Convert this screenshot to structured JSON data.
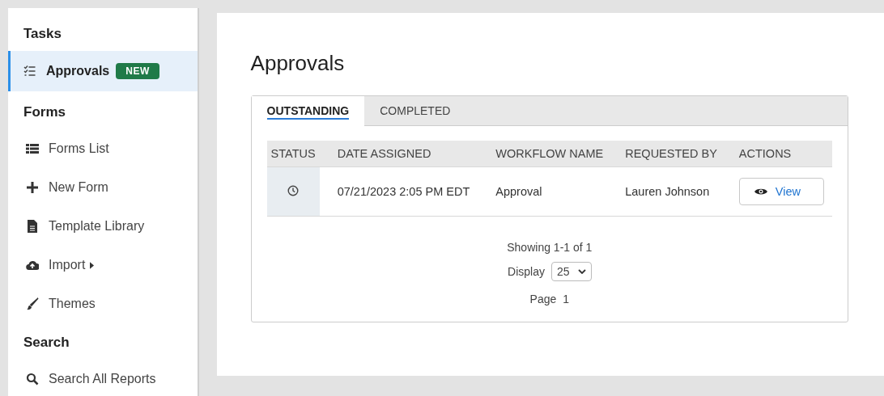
{
  "sidebar": {
    "sections": [
      {
        "heading": "Tasks",
        "items": [
          {
            "label": "Approvals",
            "badge": "NEW",
            "selected": true,
            "submenu": false
          }
        ]
      },
      {
        "heading": "Forms",
        "items": [
          {
            "label": "Forms List",
            "selected": false,
            "submenu": false
          },
          {
            "label": "New Form",
            "selected": false,
            "submenu": false
          },
          {
            "label": "Template Library",
            "selected": false,
            "submenu": false
          },
          {
            "label": "Import",
            "selected": false,
            "submenu": true
          },
          {
            "label": "Themes",
            "selected": false,
            "submenu": false
          }
        ]
      },
      {
        "heading": "Search",
        "items": [
          {
            "label": "Search All Reports",
            "selected": false,
            "submenu": false
          }
        ]
      }
    ]
  },
  "page_title": "Approvals",
  "tabs": [
    {
      "label": "OUTSTANDING",
      "selected": true
    },
    {
      "label": "COMPLETED",
      "selected": false
    }
  ],
  "table": {
    "columns": [
      "STATUS",
      "DATE ASSIGNED",
      "WORKFLOW NAME",
      "REQUESTED BY",
      "ACTIONS"
    ],
    "rows": [
      {
        "date": "07/21/2023 2:05 PM EDT",
        "workflow": "Approval",
        "requested_by": "Lauren Johnson",
        "action": "View"
      }
    ]
  },
  "pagination": {
    "summary": "Showing 1-1 of 1",
    "display_label": "Display",
    "display_value": "25",
    "page_label": "Page",
    "page": "1"
  }
}
